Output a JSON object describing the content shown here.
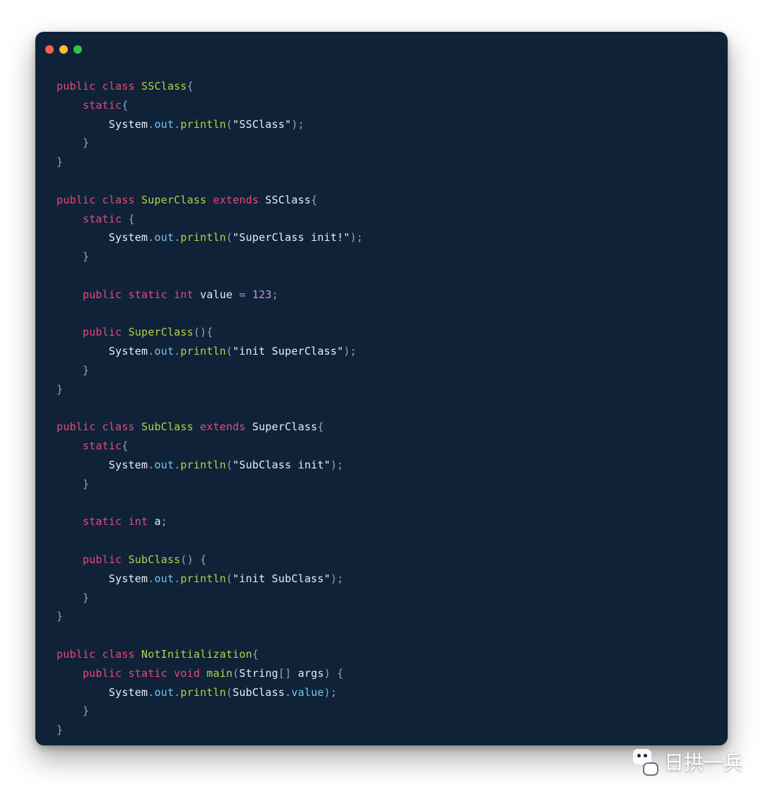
{
  "window": {
    "traffic_lights": [
      "close",
      "minimize",
      "zoom"
    ]
  },
  "watermark": {
    "text": "日拱一兵",
    "icon": "wechat-chat-icon"
  },
  "code": {
    "language": "java",
    "raw": "public class SSClass{\n    static{\n        System.out.println(\"SSClass\");\n    }\n}\n\npublic class SuperClass extends SSClass{\n    static {\n        System.out.println(\"SuperClass init!\");\n    }\n\n    public static int value = 123;\n\n    public SuperClass(){\n        System.out.println(\"init SuperClass\");\n    }\n}\n\npublic class SubClass extends SuperClass{\n    static{\n        System.out.println(\"SubClass init\");\n    }\n\n    static int a;\n\n    public SubClass() {\n        System.out.println(\"init SubClass\");\n    }\n}\n\npublic class NotInitialization{\n    public static void main(String[] args) {\n        System.out.println(SubClass.value);\n    }\n}",
    "tokens": [
      [
        [
          "public",
          "kw"
        ],
        [
          " ",
          "sp"
        ],
        [
          "class",
          "kw"
        ],
        [
          " ",
          "sp"
        ],
        [
          "SSClass",
          "cls"
        ],
        [
          "{",
          "punc"
        ]
      ],
      [
        [
          "    ",
          "sp"
        ],
        [
          "static",
          "kw"
        ],
        [
          "{",
          "punc"
        ]
      ],
      [
        [
          "        ",
          "sp"
        ],
        [
          "System",
          "id"
        ],
        [
          ".",
          "punc"
        ],
        [
          "out",
          "mem"
        ],
        [
          ".",
          "punc"
        ],
        [
          "println",
          "call"
        ],
        [
          "(",
          "punc"
        ],
        [
          "\"SSClass\"",
          "str"
        ],
        [
          ")",
          "punc"
        ],
        [
          ";",
          "punc"
        ]
      ],
      [
        [
          "    ",
          "sp"
        ],
        [
          "}",
          "punc"
        ]
      ],
      [
        [
          "}",
          "punc"
        ]
      ],
      [],
      [
        [
          "public",
          "kw"
        ],
        [
          " ",
          "sp"
        ],
        [
          "class",
          "kw"
        ],
        [
          " ",
          "sp"
        ],
        [
          "SuperClass",
          "cls"
        ],
        [
          " ",
          "sp"
        ],
        [
          "extends",
          "kw"
        ],
        [
          " ",
          "sp"
        ],
        [
          "SSClass",
          "id"
        ],
        [
          "{",
          "punc"
        ]
      ],
      [
        [
          "    ",
          "sp"
        ],
        [
          "static",
          "kw"
        ],
        [
          " ",
          "sp"
        ],
        [
          "{",
          "punc"
        ]
      ],
      [
        [
          "        ",
          "sp"
        ],
        [
          "System",
          "id"
        ],
        [
          ".",
          "punc"
        ],
        [
          "out",
          "mem"
        ],
        [
          ".",
          "punc"
        ],
        [
          "println",
          "call"
        ],
        [
          "(",
          "punc"
        ],
        [
          "\"SuperClass init!\"",
          "str"
        ],
        [
          ")",
          "punc"
        ],
        [
          ";",
          "punc"
        ]
      ],
      [
        [
          "    ",
          "sp"
        ],
        [
          "}",
          "punc"
        ]
      ],
      [],
      [
        [
          "    ",
          "sp"
        ],
        [
          "public",
          "kw"
        ],
        [
          " ",
          "sp"
        ],
        [
          "static",
          "kw"
        ],
        [
          " ",
          "sp"
        ],
        [
          "int",
          "kw"
        ],
        [
          " ",
          "sp"
        ],
        [
          "value",
          "id"
        ],
        [
          " ",
          "sp"
        ],
        [
          "=",
          "punc"
        ],
        [
          " ",
          "sp"
        ],
        [
          "123",
          "num"
        ],
        [
          ";",
          "punc"
        ]
      ],
      [],
      [
        [
          "    ",
          "sp"
        ],
        [
          "public",
          "kw"
        ],
        [
          " ",
          "sp"
        ],
        [
          "SuperClass",
          "cls"
        ],
        [
          "()",
          "punc"
        ],
        [
          "{",
          "punc"
        ]
      ],
      [
        [
          "        ",
          "sp"
        ],
        [
          "System",
          "id"
        ],
        [
          ".",
          "punc"
        ],
        [
          "out",
          "mem"
        ],
        [
          ".",
          "punc"
        ],
        [
          "println",
          "call"
        ],
        [
          "(",
          "punc"
        ],
        [
          "\"init SuperClass\"",
          "str"
        ],
        [
          ")",
          "punc"
        ],
        [
          ";",
          "punc"
        ]
      ],
      [
        [
          "    ",
          "sp"
        ],
        [
          "}",
          "punc"
        ]
      ],
      [
        [
          "}",
          "punc"
        ]
      ],
      [],
      [
        [
          "public",
          "kw"
        ],
        [
          " ",
          "sp"
        ],
        [
          "class",
          "kw"
        ],
        [
          " ",
          "sp"
        ],
        [
          "SubClass",
          "cls"
        ],
        [
          " ",
          "sp"
        ],
        [
          "extends",
          "kw"
        ],
        [
          " ",
          "sp"
        ],
        [
          "SuperClass",
          "id"
        ],
        [
          "{",
          "punc"
        ]
      ],
      [
        [
          "    ",
          "sp"
        ],
        [
          "static",
          "kw"
        ],
        [
          "{",
          "punc"
        ]
      ],
      [
        [
          "        ",
          "sp"
        ],
        [
          "System",
          "id"
        ],
        [
          ".",
          "punc"
        ],
        [
          "out",
          "mem"
        ],
        [
          ".",
          "punc"
        ],
        [
          "println",
          "call"
        ],
        [
          "(",
          "punc"
        ],
        [
          "\"SubClass init\"",
          "str"
        ],
        [
          ")",
          "punc"
        ],
        [
          ";",
          "punc"
        ]
      ],
      [
        [
          "    ",
          "sp"
        ],
        [
          "}",
          "punc"
        ]
      ],
      [],
      [
        [
          "    ",
          "sp"
        ],
        [
          "static",
          "kw"
        ],
        [
          " ",
          "sp"
        ],
        [
          "int",
          "kw"
        ],
        [
          " ",
          "sp"
        ],
        [
          "a",
          "id"
        ],
        [
          ";",
          "punc"
        ]
      ],
      [],
      [
        [
          "    ",
          "sp"
        ],
        [
          "public",
          "kw"
        ],
        [
          " ",
          "sp"
        ],
        [
          "SubClass",
          "cls"
        ],
        [
          "()",
          "punc"
        ],
        [
          " ",
          "sp"
        ],
        [
          "{",
          "punc"
        ]
      ],
      [
        [
          "        ",
          "sp"
        ],
        [
          "System",
          "id"
        ],
        [
          ".",
          "punc"
        ],
        [
          "out",
          "mem"
        ],
        [
          ".",
          "punc"
        ],
        [
          "println",
          "call"
        ],
        [
          "(",
          "punc"
        ],
        [
          "\"init SubClass\"",
          "str"
        ],
        [
          ")",
          "punc"
        ],
        [
          ";",
          "punc"
        ]
      ],
      [
        [
          "    ",
          "sp"
        ],
        [
          "}",
          "punc"
        ]
      ],
      [
        [
          "}",
          "punc"
        ]
      ],
      [],
      [
        [
          "public",
          "kw"
        ],
        [
          " ",
          "sp"
        ],
        [
          "class",
          "kw"
        ],
        [
          " ",
          "sp"
        ],
        [
          "NotInitialization",
          "cls"
        ],
        [
          "{",
          "punc"
        ]
      ],
      [
        [
          "    ",
          "sp"
        ],
        [
          "public",
          "kw"
        ],
        [
          " ",
          "sp"
        ],
        [
          "static",
          "kw"
        ],
        [
          " ",
          "sp"
        ],
        [
          "void",
          "kw"
        ],
        [
          " ",
          "sp"
        ],
        [
          "main",
          "call"
        ],
        [
          "(",
          "punc"
        ],
        [
          "String",
          "id"
        ],
        [
          "[]",
          "punc"
        ],
        [
          " ",
          "sp"
        ],
        [
          "args",
          "id"
        ],
        [
          ")",
          "punc"
        ],
        [
          " ",
          "sp"
        ],
        [
          "{",
          "punc"
        ]
      ],
      [
        [
          "        ",
          "sp"
        ],
        [
          "System",
          "id"
        ],
        [
          ".",
          "punc"
        ],
        [
          "out",
          "mem"
        ],
        [
          ".",
          "punc"
        ],
        [
          "println",
          "call"
        ],
        [
          "(",
          "punc"
        ],
        [
          "SubClass",
          "id"
        ],
        [
          ".",
          "punc"
        ],
        [
          "value",
          "mem"
        ],
        [
          ")",
          "punc"
        ],
        [
          ";",
          "punc"
        ]
      ],
      [
        [
          "    ",
          "sp"
        ],
        [
          "}",
          "punc"
        ]
      ],
      [
        [
          "}",
          "punc"
        ]
      ]
    ]
  }
}
